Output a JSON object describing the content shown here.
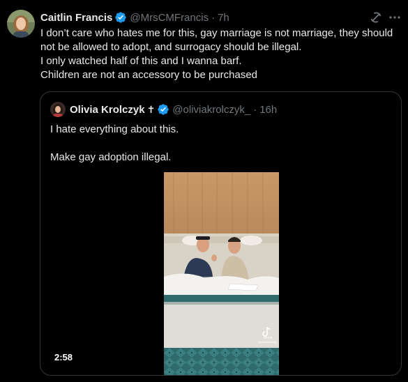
{
  "author": {
    "name": "Caitlin Francis",
    "handle": "@MrsCMFrancis",
    "separator": "·",
    "time": "7h"
  },
  "tweet_lines": [
    "I don’t care who hates me for this, gay marriage is not marriage, they should",
    "not be allowed to adopt, and surrogacy should be illegal.",
    "I only watched half of this and I wanna barf.",
    "Children are not an accessory to be purchased"
  ],
  "quoted": {
    "name": "Olivia Krolczyk",
    "name_suffix": "✝",
    "handle": "@oliviakrolczyk_",
    "separator": "·",
    "time": "16h",
    "line1": "I hate everything about this.",
    "line2": "Make gay adoption illegal."
  },
  "video": {
    "duration": "2:58",
    "watermark": "TikTok",
    "watermark_handle": "@ourfamilyvlog"
  },
  "icons": {
    "verified": "verified-badge-icon",
    "grok": "grok-icon",
    "more": "more-options-icon"
  },
  "colors": {
    "background": "#000000",
    "text": "#e7e9ea",
    "muted": "#71767b",
    "verified": "#1d9bf0",
    "border": "#333639"
  }
}
